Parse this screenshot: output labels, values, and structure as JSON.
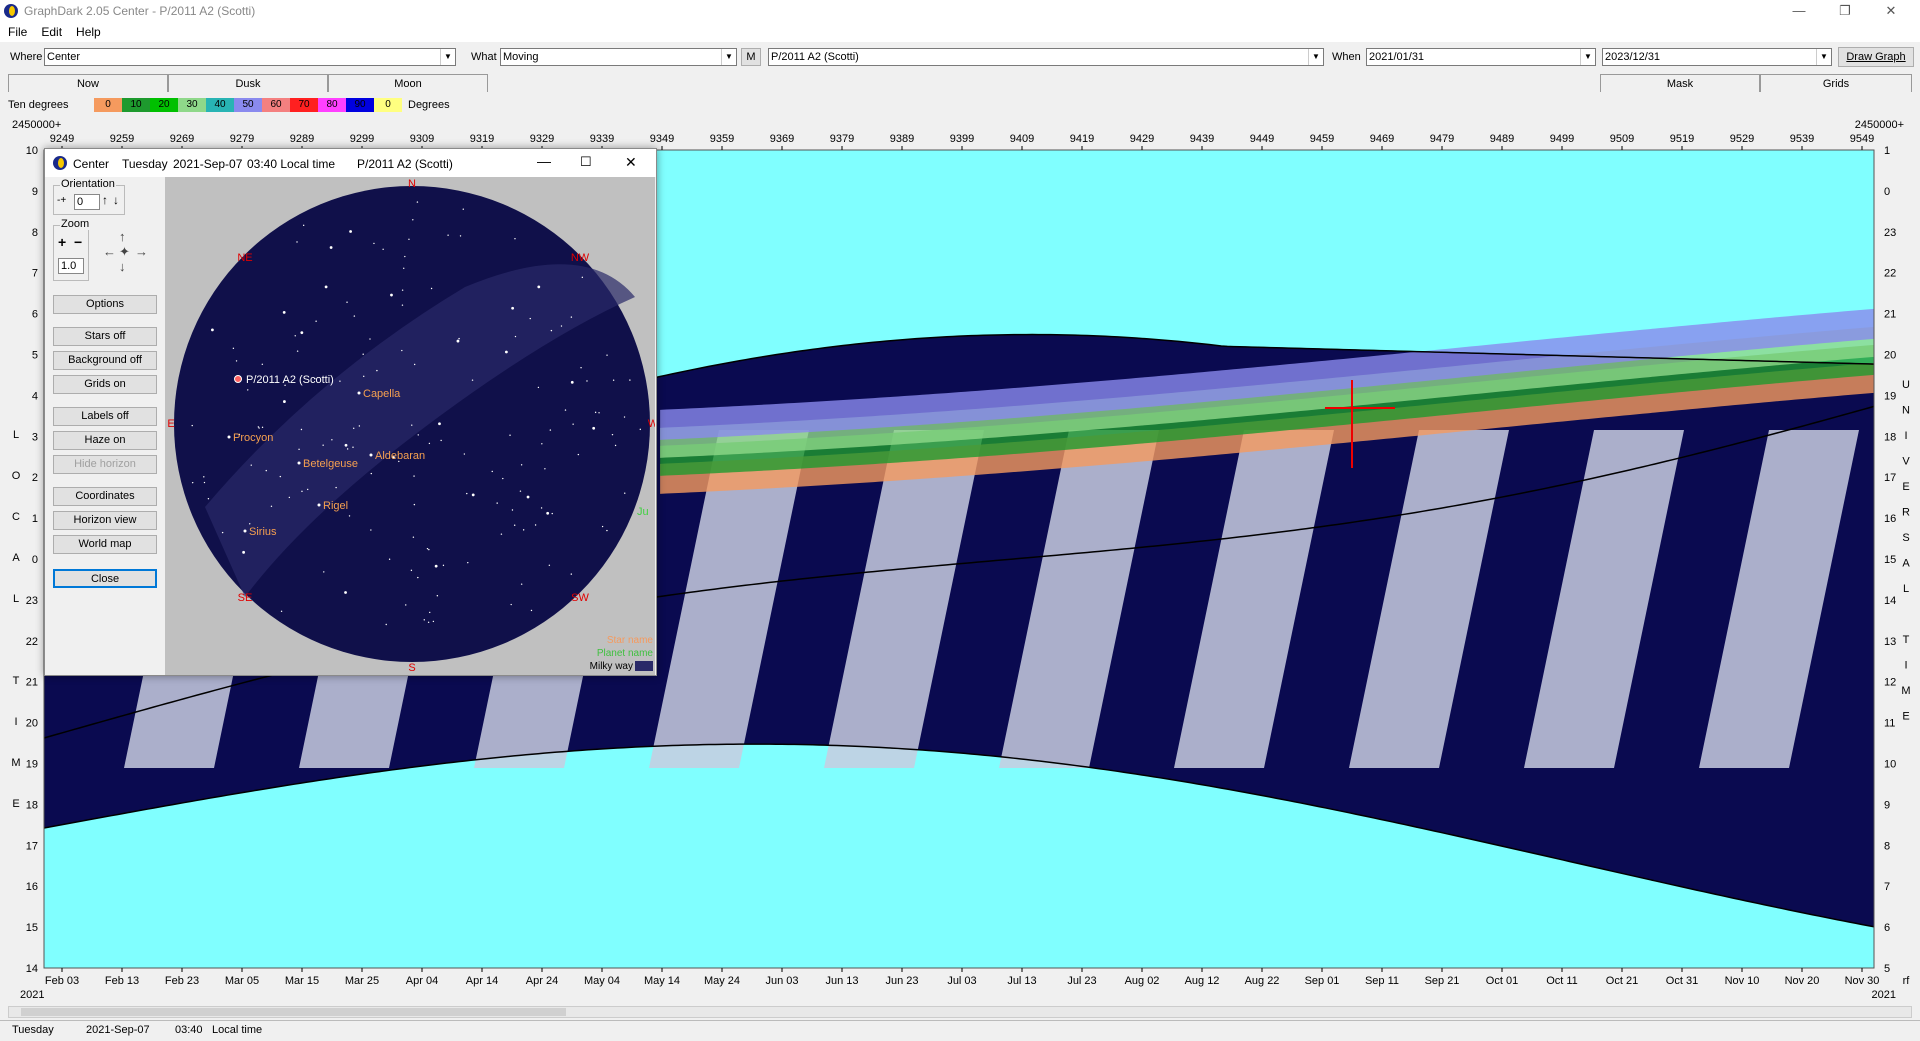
{
  "window": {
    "title": "GraphDark 2.05 Center  -  P/2011 A2 (Scotti)",
    "minimize": "—",
    "maximize": "❐",
    "close": "✕"
  },
  "menu": [
    "File",
    "Edit",
    "Help"
  ],
  "toolbar": {
    "where_label": "Where",
    "where_value": "Center",
    "what_label": "What",
    "what_value": "Moving",
    "m_label": "M",
    "object_value": "P/2011 A2 (Scotti)",
    "when_label": "When",
    "when_start": "2021/01/31",
    "when_end": "2023/12/31",
    "draw_label": "Draw Graph"
  },
  "tabs": {
    "now": "Now",
    "dusk": "Dusk",
    "moon": "Moon",
    "mask": "Mask",
    "grids": "Grids"
  },
  "legend": {
    "label": "Ten degrees",
    "unit": "Degrees",
    "steps": [
      {
        "v": "0",
        "c": "#f59a5e"
      },
      {
        "v": "10",
        "c": "#1e9a2e"
      },
      {
        "v": "20",
        "c": "#00c000"
      },
      {
        "v": "30",
        "c": "#8fd88a"
      },
      {
        "v": "40",
        "c": "#28b4b4"
      },
      {
        "v": "50",
        "c": "#8a8aee"
      },
      {
        "v": "60",
        "c": "#f48080"
      },
      {
        "v": "70",
        "c": "#ff2020"
      },
      {
        "v": "80",
        "c": "#ff40ff"
      },
      {
        "v": "90",
        "c": "#0000e0"
      },
      {
        "v": "0",
        "c": "#ffff80"
      }
    ]
  },
  "chart": {
    "top_left_label": "2450000+",
    "top_right_label": "2450000+",
    "jd_ticks": [
      "9249",
      "9259",
      "9269",
      "9279",
      "9289",
      "9299",
      "9309",
      "9319",
      "9329",
      "9339",
      "9349",
      "9359",
      "9369",
      "9379",
      "9389",
      "9399",
      "9409",
      "9419",
      "9429",
      "9439",
      "9449",
      "9459",
      "9469",
      "9479",
      "9489",
      "9499",
      "9509",
      "9519",
      "9529",
      "9539",
      "9549"
    ],
    "date_ticks": [
      "Feb 03",
      "Feb 13",
      "Feb 23",
      "Mar 05",
      "Mar 15",
      "Mar 25",
      "Apr 04",
      "Apr 14",
      "Apr 24",
      "May 04",
      "May 14",
      "May 24",
      "Jun 03",
      "Jun 13",
      "Jun 23",
      "Jul 03",
      "Jul 13",
      "Jul 23",
      "Aug 02",
      "Aug 12",
      "Aug 22",
      "Sep 01",
      "Sep 11",
      "Sep 21",
      "Oct 01",
      "Oct 11",
      "Oct 21",
      "Oct 31",
      "Nov 10",
      "Nov 20",
      "Nov 30"
    ],
    "year_left": "2021",
    "year_right": "2021",
    "corner_label": "rf",
    "left_hours": [
      "10",
      "9",
      "8",
      "7",
      "6",
      "5",
      "4",
      "3",
      "2",
      "1",
      "0",
      "23",
      "22",
      "21",
      "20",
      "19",
      "18",
      "17",
      "16",
      "15",
      "14"
    ],
    "right_hours": [
      "1",
      "0",
      "23",
      "22",
      "21",
      "20",
      "19",
      "18",
      "17",
      "16",
      "15",
      "14",
      "13",
      "12",
      "11",
      "10",
      "9",
      "8",
      "7",
      "6",
      "5"
    ],
    "left_axis_letters": [
      "L",
      "O",
      "C",
      "A",
      "L",
      "",
      "T",
      "I",
      "M",
      "E"
    ],
    "right_axis_letters": [
      "U",
      "N",
      "I",
      "V",
      "E",
      "R",
      "S",
      "A",
      "L",
      "",
      "T",
      "I",
      "M",
      "E"
    ]
  },
  "status": {
    "day": "Tuesday",
    "date": "2021-Sep-07",
    "time": "03:40",
    "tz": "Local time"
  },
  "dialog": {
    "title_place": "Center",
    "title_day": "Tuesday",
    "title_date": "2021-Sep-07",
    "title_time": "03:40 Local time",
    "title_object": "P/2011 A2 (Scotti)",
    "orientation_label": "Orientation",
    "orientation_value": "0",
    "zoom_label": "Zoom",
    "zoom_value": "1.0",
    "buttons": [
      "Options",
      "Stars off",
      "Background off",
      "Grids on",
      "Labels off",
      "Haze on",
      "Hide horizon",
      "Coordinates",
      "Horizon view",
      "World map",
      "Close"
    ],
    "compass": {
      "n": "N",
      "s": "S",
      "e": "E",
      "w": "W",
      "ne": "NE",
      "nw": "NW",
      "se": "SE",
      "sw": "SW"
    },
    "object_label": "P/2011 A2 (Scotti)",
    "stars": [
      "Capella",
      "Procyon",
      "Aldebaran",
      "Betelgeuse",
      "Rigel",
      "Sirius"
    ],
    "planet": "Ju",
    "legend": {
      "star": "Star name",
      "planet": "Planet name",
      "milky": "Milky way"
    }
  }
}
